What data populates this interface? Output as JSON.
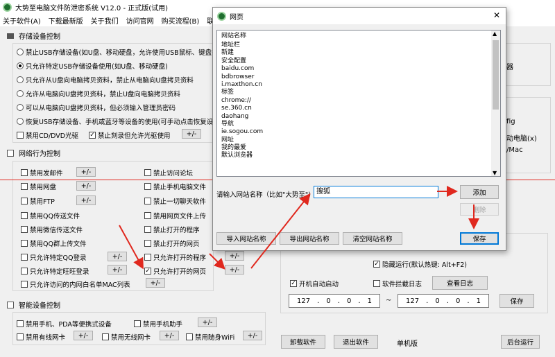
{
  "app": {
    "title": "大势至电脑文件防泄密系统 V12.0 - 正式版(试用)"
  },
  "menu": [
    "关于软件(A)",
    "下载最新版",
    "关于我们",
    "访问官网",
    "购买流程(B)",
    "联系"
  ],
  "storage": {
    "title": "存储设备控制",
    "options": [
      "禁止USB存储设备(如U盘、移动硬盘，允许使用USB鼠标、键盘等",
      "只允许特定USB存储设备使用(如U盘、移动硬盘)",
      "只允许从U盘向电脑拷贝资料，禁止从电脑向U盘拷贝资料",
      "允许从电脑向U盘拷贝资料，禁止U盘向电脑拷贝资料",
      "可以从电脑向U盘拷贝资料，但必须输入管理员密码",
      "恢复USB存储设备、手机或蓝牙等设备的使用(可手动点击恢复设"
    ],
    "cd_label": "禁用CD/DVD光驱",
    "burn_label": "禁止刻录但允许光驱使用",
    "plus": "+/-"
  },
  "network": {
    "title": "网络行为控制",
    "left": [
      "禁用发邮件",
      "禁用网盘",
      "禁用FTP",
      "禁用QQ传送文件",
      "禁用微信传送文件",
      "禁用QQ群上传文件",
      "只允许特定QQ登录",
      "只允许特定旺旺登录",
      "只允许访问的内网白名单MAC列表"
    ],
    "right": [
      "禁止访问论坛",
      "禁止手机电脑文件",
      "禁止一切聊天软件",
      "禁用网页文件上传",
      "禁止打开的程序",
      "禁止打开的网页",
      "只允许打开的程序",
      "只允许打开的网页"
    ]
  },
  "smart": {
    "title": "智能设备控制",
    "items": [
      "禁用手机、PDA等便携式设备",
      "禁用手机助手",
      "禁用有线网卡",
      "禁用无线网卡",
      "禁用随身WiFi"
    ]
  },
  "right_panel": {
    "frag1": "器",
    "frag2": "fig",
    "frag3": "动电脑(x)",
    "frag4": "/Mac",
    "hide_run": "隐藏运行(默认热键: Alt+F2)",
    "autostart": "开机自动启动",
    "block_log": "软件拦截日志",
    "view_log": "查看日志",
    "ip1": [
      "127",
      "0",
      "0",
      "1"
    ],
    "ip2": [
      "127",
      "0",
      "0",
      "1"
    ],
    "tilde": "~",
    "save": "保存",
    "uninstall": "卸载软件",
    "exit": "退出软件",
    "edition": "单机版",
    "background": "后台运行"
  },
  "dialog": {
    "title": "网页",
    "header": "网站名称",
    "items": [
      "地址栏",
      "新建",
      "安全配置",
      "baidu.com",
      "bdbrowser",
      "i.maxthon.cn",
      "标签",
      "chrome://",
      "se.360.cn",
      "daohang",
      "导航",
      "ie.sogou.com",
      "网址",
      "我的最爱",
      "默认浏览器"
    ],
    "input_label": "请输入网站名称（比如\"大势至\")",
    "input_value": "搜狐",
    "add": "添加",
    "delete": "删除",
    "import": "导入网站名称",
    "export": "导出网站名称",
    "clear": "清空网站名称",
    "save": "保存",
    "close": "✕"
  }
}
